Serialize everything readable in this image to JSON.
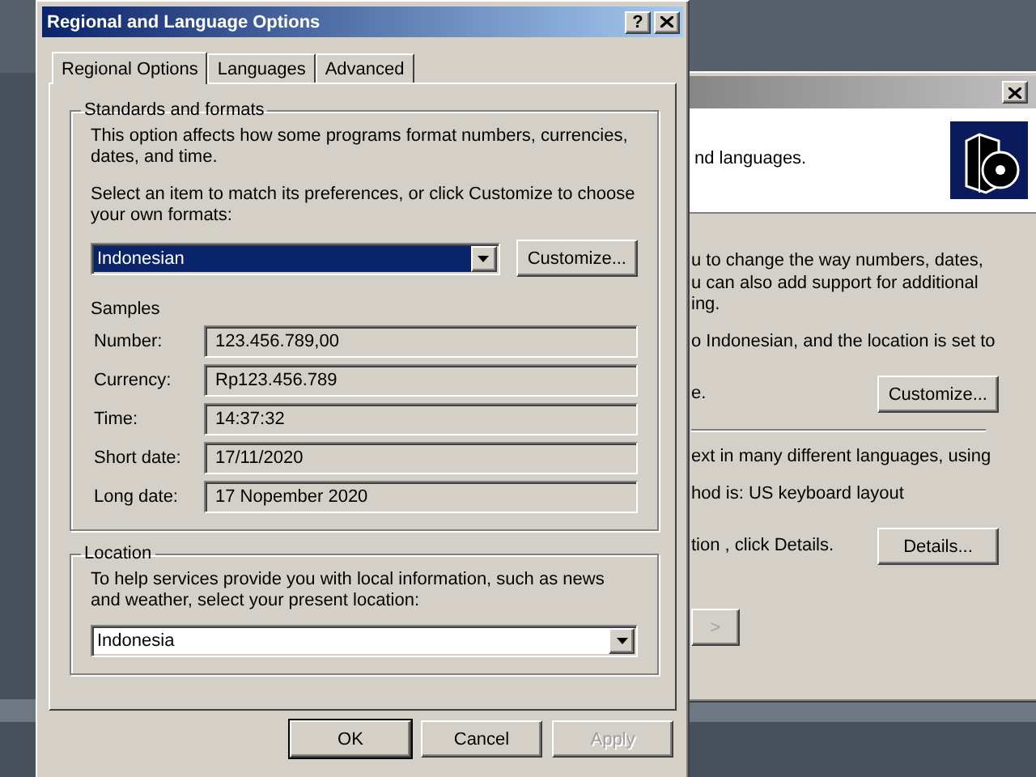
{
  "back_window": {
    "header_text": "nd languages.",
    "items": [
      {
        "kind": "line",
        "text": "u to change the way numbers, dates,"
      },
      {
        "kind": "line",
        "text": "u can also add support for additional"
      },
      {
        "kind": "line",
        "text": "ing."
      },
      {
        "kind": "para",
        "text": "o Indonesian, and the location is set to"
      },
      {
        "kind": "button_row",
        "text": "e.",
        "button": "Customize..."
      },
      {
        "kind": "divider"
      },
      {
        "kind": "para",
        "text": "ext in many different languages, using"
      },
      {
        "kind": "para",
        "text": "hod is: US keyboard layout"
      },
      {
        "kind": "button_row",
        "text": "tion , click Details.",
        "button": "Details..."
      },
      {
        "kind": "nav_button",
        "button": ">"
      }
    ]
  },
  "dialog": {
    "title": "Regional and Language Options",
    "help_button": "?",
    "tabs": [
      {
        "label": "Regional Options",
        "selected": true
      },
      {
        "label": "Languages",
        "selected": false
      },
      {
        "label": "Advanced",
        "selected": false
      }
    ],
    "standards": {
      "legend": "Standards and formats",
      "description": "This option affects how some programs format numbers, currencies, dates, and time.",
      "prompt": "Select an item to match its preferences, or click Customize to choose your own formats:",
      "format": {
        "value": "Indonesian",
        "selected": true
      },
      "customize_button": "Customize...",
      "samples_label": "Samples",
      "samples": [
        {
          "label": "Number:",
          "value": "123.456.789,00"
        },
        {
          "label": "Currency:",
          "value": "Rp123.456.789"
        },
        {
          "label": "Time:",
          "value": "14:37:32"
        },
        {
          "label": "Short date:",
          "value": "17/11/2020"
        },
        {
          "label": "Long date:",
          "value": "17 Nopember 2020"
        }
      ]
    },
    "location": {
      "legend": "Location",
      "description": "To help services provide you with local information, such as news and weather, select your present location:",
      "value": "Indonesia",
      "selected": false
    },
    "buttons": [
      {
        "label": "OK",
        "default": true,
        "disabled": false
      },
      {
        "label": "Cancel",
        "default": false,
        "disabled": false
      },
      {
        "label": "Apply",
        "default": false,
        "disabled": true
      }
    ]
  }
}
